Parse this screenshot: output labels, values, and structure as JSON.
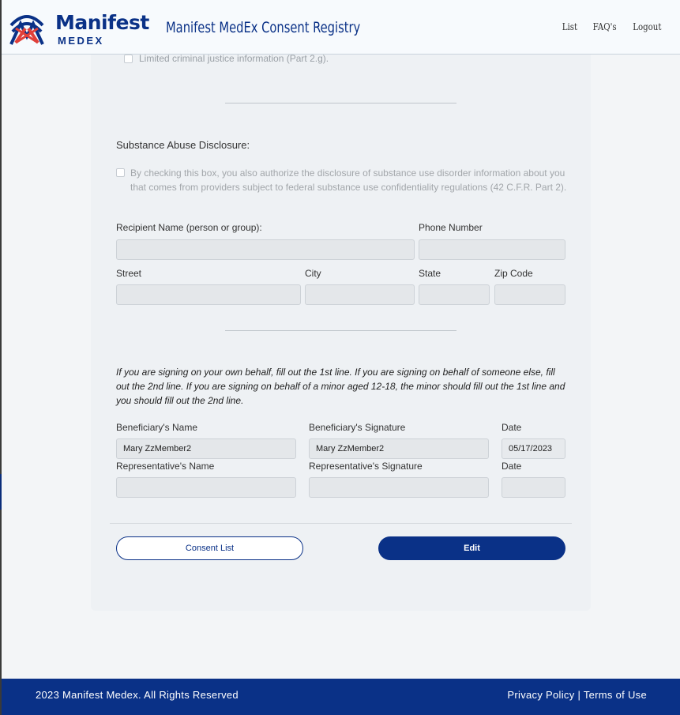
{
  "header": {
    "brand_name": "Manifest",
    "brand_sub": "MEDEX",
    "app_title": "Manifest MedEx Consent Registry",
    "nav": [
      "List",
      "FAQ's",
      "Logout"
    ]
  },
  "form": {
    "faded_item": "Limited criminal justice information (Part 2.g).",
    "substance_title": "Substance Abuse Disclosure:",
    "substance_text": "By checking this box, you also authorize the disclosure of substance use disorder information about you that comes from providers subject to federal substance use confidentiality regulations (42 C.F.R. Part 2).",
    "recipient_label": "Recipient Name (person or group):",
    "phone_label": "Phone Number",
    "street_label": "Street",
    "city_label": "City",
    "state_label": "State",
    "zip_label": "Zip Code",
    "instructions": "If you are signing on your own behalf, fill out the 1st line. If you are signing on behalf of someone else, fill out the 2nd line. If you are signing on behalf of a minor aged 12-18, the minor should fill out the 1st line and you should fill out the 2nd line.",
    "beneficiary_name_label": "Beneficiary's Name",
    "beneficiary_sig_label": "Beneficiary's Signature",
    "date_label": "Date",
    "beneficiary_name": "Mary ZzMember2",
    "beneficiary_sig": "Mary ZzMember2",
    "beneficiary_date": "05/17/2023",
    "rep_name_label": "Representative's Name",
    "rep_sig_label": "Representative's Signature",
    "rep_date_label": "Date",
    "consent_list_btn": "Consent List",
    "edit_btn": "Edit"
  },
  "footer": {
    "copyright": "2023 Manifest Medex. All Rights Reserved",
    "privacy": "Privacy Policy",
    "separator": "|",
    "terms": "Terms of Use"
  },
  "colors": {
    "brand_blue": "#0a3187",
    "logo_red": "#e0403a"
  },
  "icons": {
    "logo": "manifest-medex-logo",
    "checkbox": "checkbox-unchecked"
  }
}
